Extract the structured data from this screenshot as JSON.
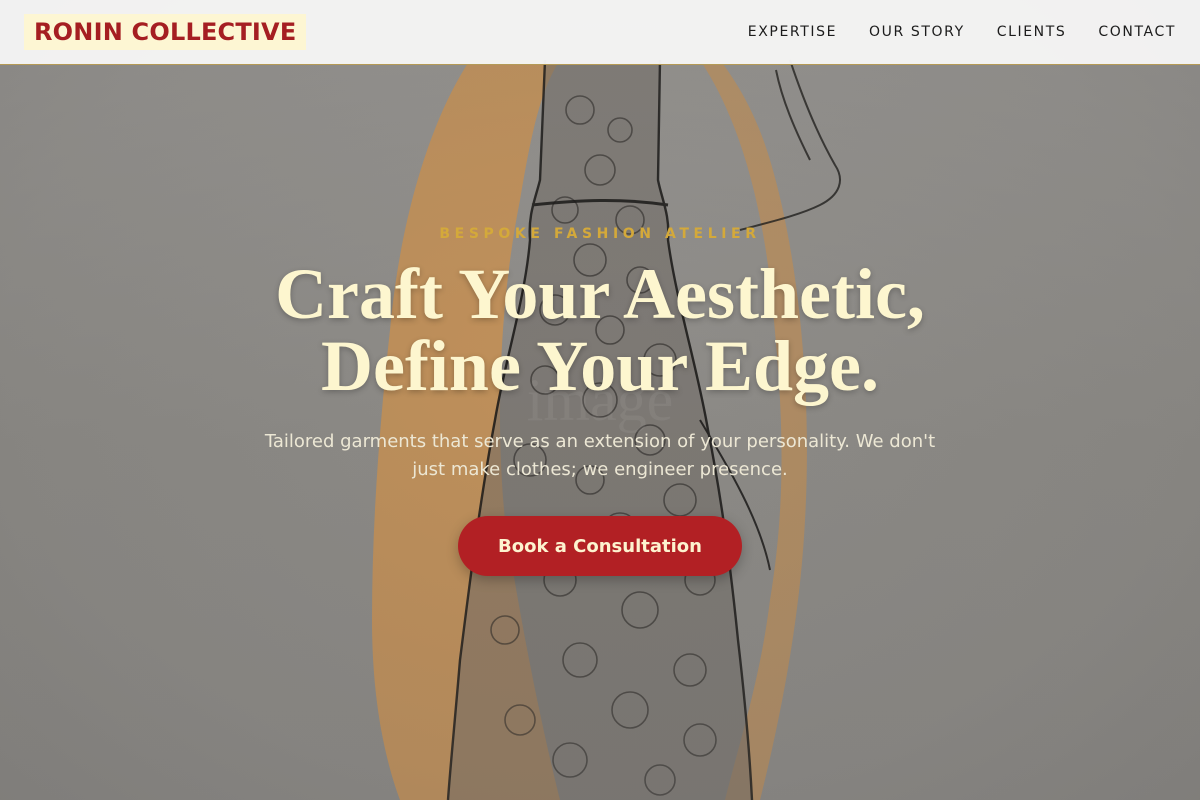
{
  "header": {
    "brand": "RONIN COLLECTIVE",
    "nav": [
      "EXPERTISE",
      "OUR STORY",
      "CLIENTS",
      "CONTACT"
    ]
  },
  "hero": {
    "eyebrow": "BESPOKE FASHION ATELIER",
    "headline_line1": "Craft Your Aesthetic,",
    "headline_line2": "Define Your Edge.",
    "subhead": "Tailored garments that serve as an extension of your personality. We don't just make clothes; we engineer presence.",
    "cta_label": "Book a Consultation",
    "background_image": "fashion-sketch-dress-illustration"
  },
  "colors": {
    "brand_red": "#a51e22",
    "brand_bg": "#fdf6d3",
    "accent_gold": "#d4a93a",
    "headline_cream": "#fdf6cf",
    "cta_red": "#b22024"
  }
}
